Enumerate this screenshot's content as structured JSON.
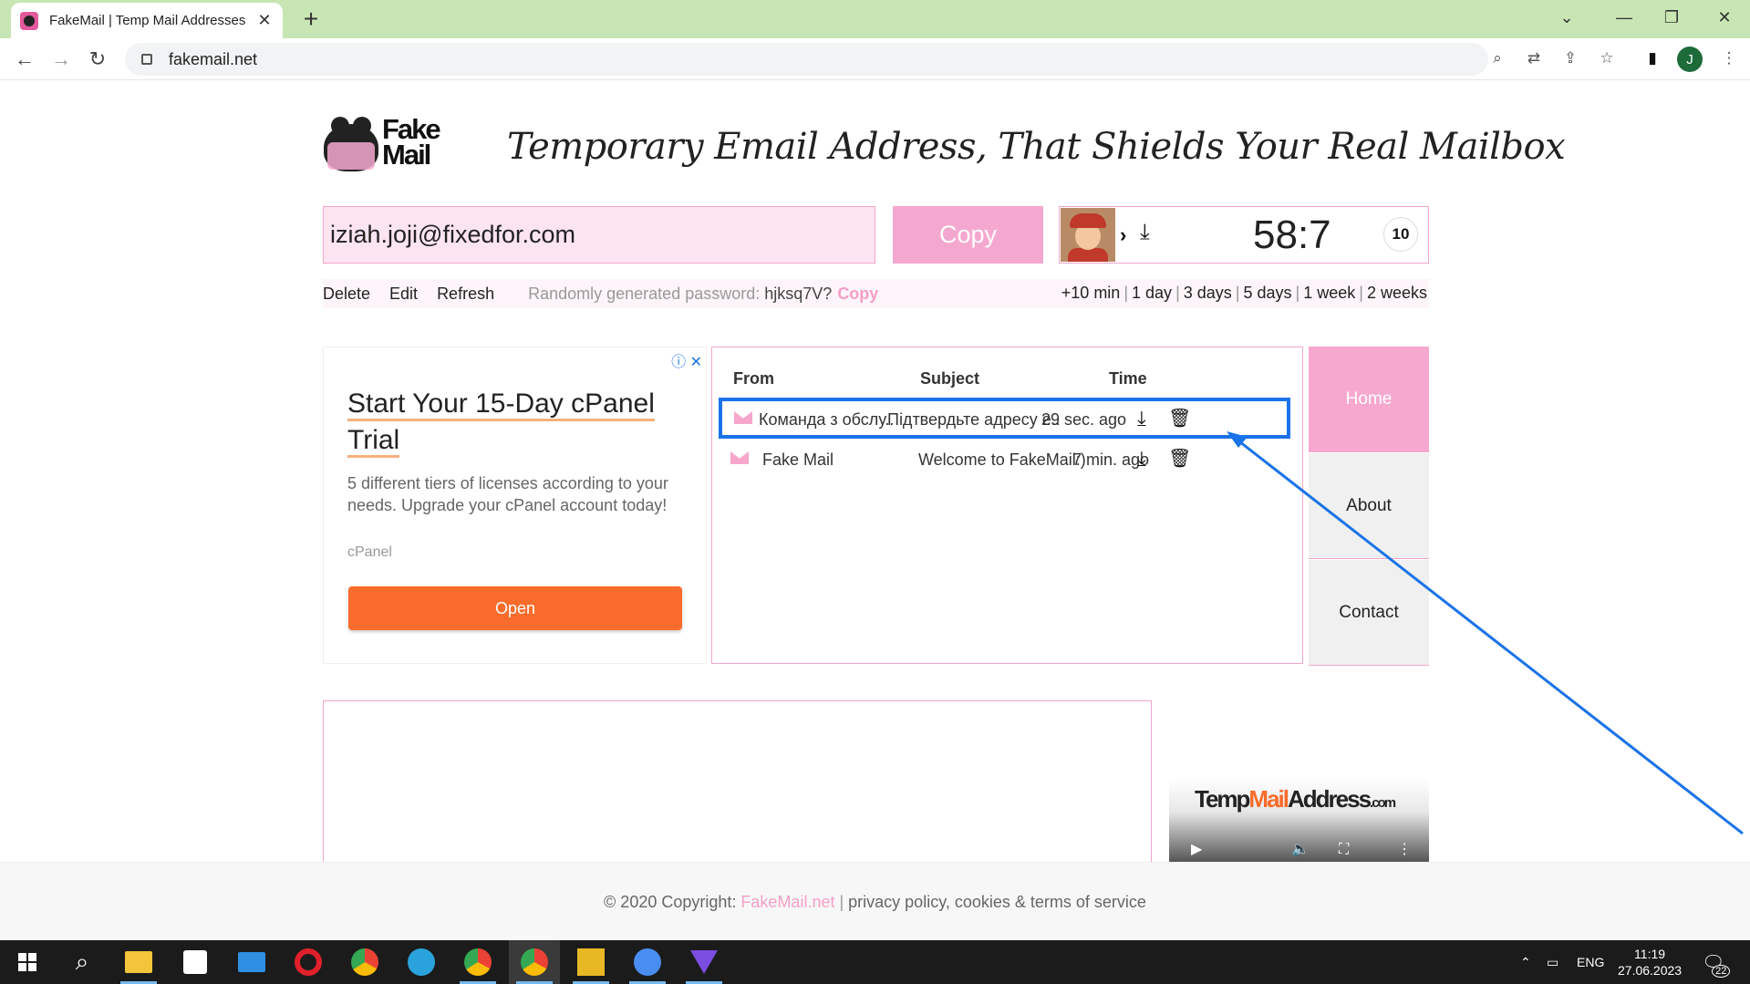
{
  "browser": {
    "tab_title": "FakeMail | Temp Mail Addresses",
    "url": "fakemail.net",
    "profile_initial": "J"
  },
  "header": {
    "logo_line1": "Fake",
    "logo_line2": "Mail",
    "tagline": "Temporary Email Address, That Shields Your Real Mailbox"
  },
  "email": {
    "address": "iziah.joji@fixedfor.com",
    "copy_label": "Copy",
    "timer": "58:7",
    "counter": "10"
  },
  "actions": {
    "delete": "Delete",
    "edit": "Edit",
    "refresh": "Refresh",
    "password_label": "Randomly generated password:",
    "password": "hjksq7V?",
    "password_copy": "Copy",
    "extend": [
      "+10 min",
      "1 day",
      "3 days",
      "5 days",
      "1 week",
      "2 weeks"
    ]
  },
  "ad": {
    "title": "Start Your 15-Day cPanel Trial",
    "body": "5 different tiers of licenses according to your needs. Upgrade your cPanel account today!",
    "brand": "cPanel",
    "cta": "Open"
  },
  "inbox": {
    "headers": {
      "from": "From",
      "subject": "Subject",
      "time": "Time"
    },
    "rows": [
      {
        "from": "Команда з обслу...",
        "subject": "Підтвердьте адресу е...",
        "time": "29 sec. ago"
      },
      {
        "from": "Fake Mail",
        "subject": "Welcome to FakeMail:)",
        "time": "7 min. ago"
      }
    ]
  },
  "nav": {
    "items": [
      "Home",
      "About",
      "Contact"
    ]
  },
  "video": {
    "logo_pre": "Temp",
    "logo_mid": "Mail",
    "logo_post": "Address",
    "logo_tld": ".com"
  },
  "footer": {
    "copyright": "© 2020 Copyright:",
    "site": "FakeMail.net",
    "policy": "privacy policy, cookies & terms of service"
  },
  "taskbar": {
    "lang": "ENG",
    "time": "11:19",
    "date": "27.06.2023",
    "notifications": "22"
  },
  "colors": {
    "accent_pink": "#f5a8cf",
    "highlight_blue": "#1a73e8",
    "cta_orange": "#f96c2b"
  }
}
